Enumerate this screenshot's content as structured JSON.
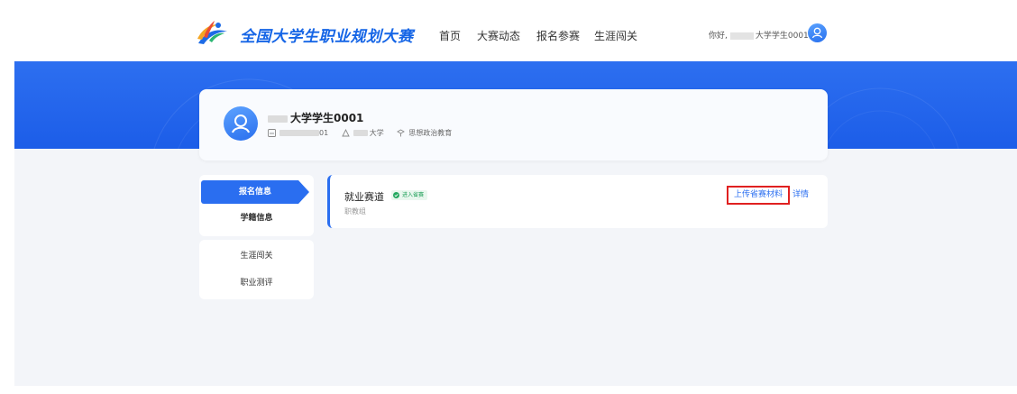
{
  "header": {
    "brand": "全国大学生职业规划大赛",
    "nav": [
      {
        "label": "首页",
        "name": "nav-home"
      },
      {
        "label": "大赛动态",
        "name": "nav-news"
      },
      {
        "label": "报名参赛",
        "name": "nav-register"
      },
      {
        "label": "生涯闯关",
        "name": "nav-career-challenge"
      }
    ],
    "greeting_prefix": "你好,",
    "greeting_user": "大学学生0001"
  },
  "profile": {
    "name": "大学学生0001",
    "id_suffix": "01",
    "school_suffix": "大学",
    "major": "思想政治教育"
  },
  "sidebar": {
    "group1": [
      "报名信息",
      "学籍信息"
    ],
    "group2": [
      "生涯闯关",
      "职业测评"
    ]
  },
  "competition": {
    "title": "就业赛道",
    "badge": "进入省赛",
    "group": "职教组",
    "upload_label": "上传省赛材料",
    "detail_label": "详情"
  },
  "colors": {
    "primary": "#2a6ef0",
    "brand_text": "#1565e6",
    "success": "#22a85e",
    "highlight_border": "#e02020"
  }
}
